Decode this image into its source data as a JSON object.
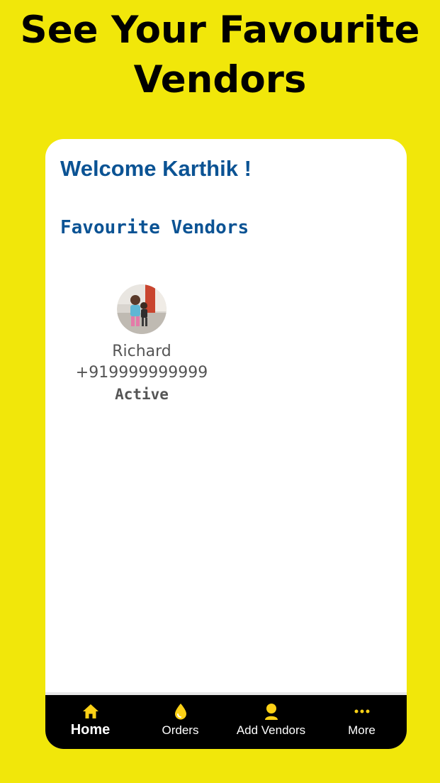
{
  "headline": {
    "line1": "See Your Favourite",
    "line2": "Vendors"
  },
  "app": {
    "welcome": "Welcome Karthik !",
    "section_title": "Favourite Vendors"
  },
  "vendors": [
    {
      "name": "Richard",
      "phone": "+919999999999",
      "status": "Active"
    }
  ],
  "bottom_nav": {
    "items": [
      {
        "label": "Home",
        "icon": "home-icon",
        "active": true
      },
      {
        "label": "Orders",
        "icon": "drop-icon",
        "active": false
      },
      {
        "label": "Add Vendors",
        "icon": "person-icon",
        "active": false
      },
      {
        "label": "More",
        "icon": "more-dots-icon",
        "active": false
      }
    ]
  },
  "colors": {
    "background": "#f1e70a",
    "accent": "#fcd116",
    "heading_blue": "#0b5394",
    "nav_bg": "#000000"
  }
}
